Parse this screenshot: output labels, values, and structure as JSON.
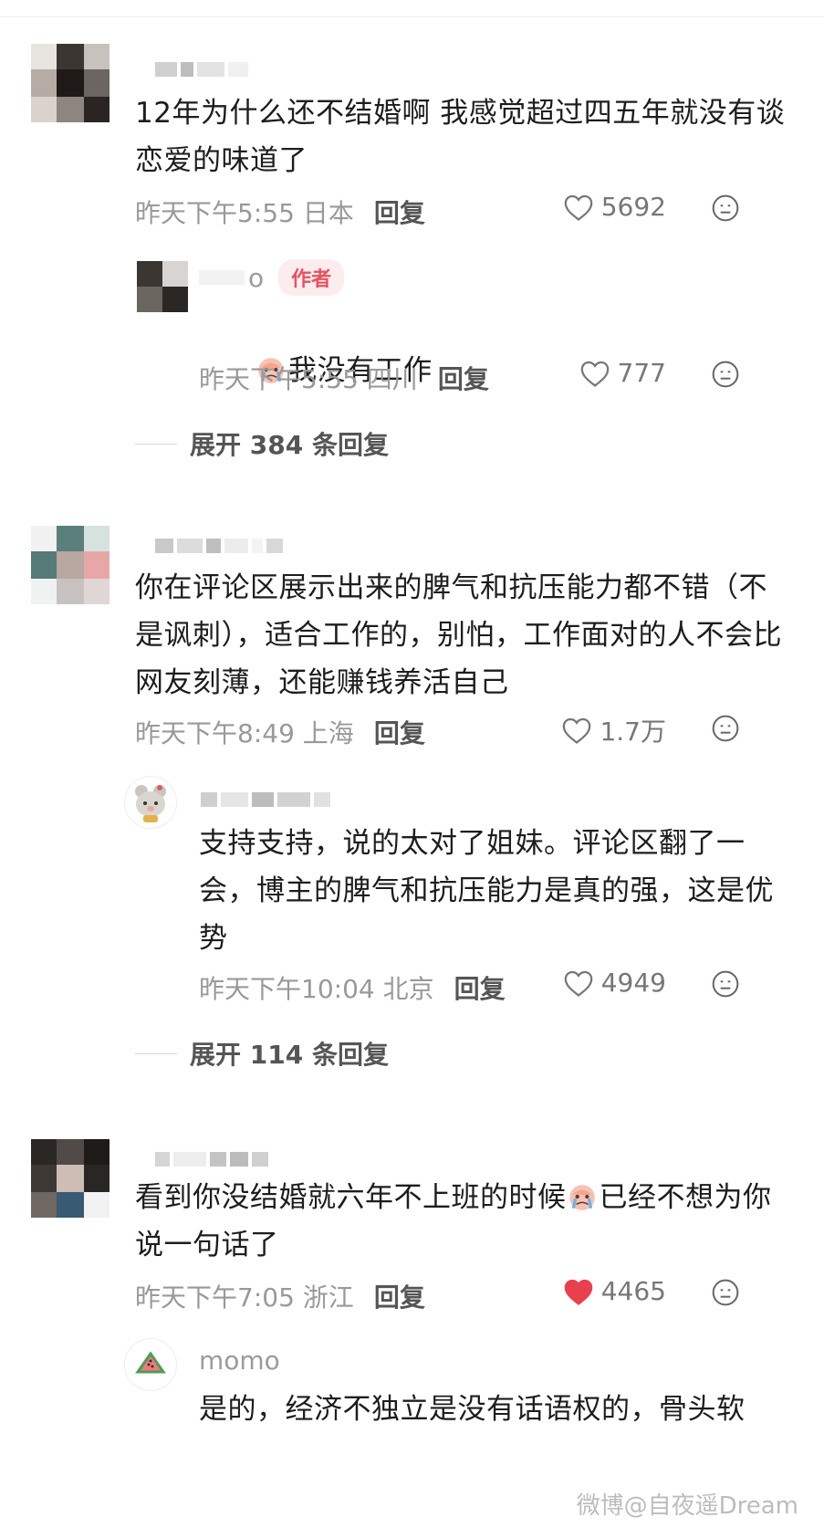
{
  "comments": [
    {
      "text": "12年为什么还不结婚啊 我感觉超过四五年就没有谈恋爱的味道了",
      "time": "昨天下午5:55",
      "location": "日本",
      "reply_label": "回复",
      "likes": "5692",
      "liked": false,
      "reply": {
        "name_suffix": "o",
        "badge": "作者",
        "text": "我没有工作",
        "time": "昨天下午5:55",
        "location": "四川",
        "reply_label": "回复",
        "likes": "777",
        "liked": false
      },
      "expand": "展开 384 条回复"
    },
    {
      "text": "你在评论区展示出来的脾气和抗压能力都不错（不是讽刺），适合工作的，别怕，工作面对的人不会比网友刻薄，还能赚钱养活自己",
      "time": "昨天下午8:49",
      "location": "上海",
      "reply_label": "回复",
      "likes": "1.7万",
      "liked": false,
      "reply": {
        "text": "支持支持，说的太对了姐妹。评论区翻了一会，博主的脾气和抗压能力是真的强，这是优势",
        "time": "昨天下午10:04",
        "location": "北京",
        "reply_label": "回复",
        "likes": "4949",
        "liked": false
      },
      "expand": "展开 114 条回复"
    },
    {
      "text_before_emoji": "看到你没结婚就六年不上班的时候",
      "text_after_emoji": "已经不想为你说一句话了",
      "time": "昨天下午7:05",
      "location": "浙江",
      "reply_label": "回复",
      "likes": "4465",
      "liked": true,
      "reply": {
        "name": "momo",
        "text": "是的，经济不独立是没有话语权的，骨头软"
      }
    }
  ],
  "watermark": "微博@自夜遥Dream",
  "colors": {
    "like_active": "#e8404f",
    "badge_bg": "#fdecee",
    "badge_text": "#e8515f",
    "meta": "#999999"
  },
  "icons": [
    "heart-outline-icon",
    "heart-filled-icon",
    "dislike-face-icon",
    "crying-emoji-icon",
    "watermelon-icon",
    "bear-sticker-avatar"
  ]
}
